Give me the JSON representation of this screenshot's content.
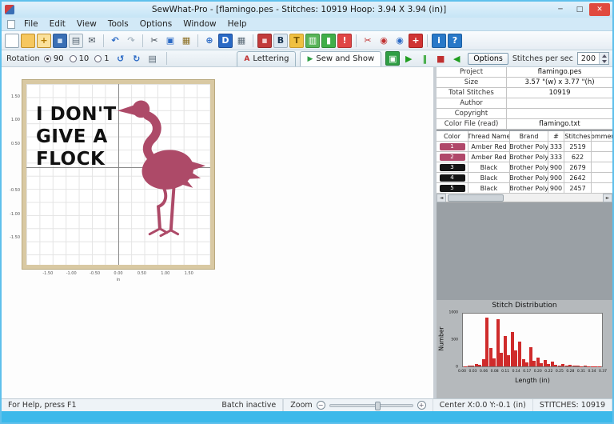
{
  "window": {
    "title": "SewWhat-Pro - [flamingo.pes - Stitches: 10919  Hoop: 3.94 X 3.94 (in)]",
    "controls": {
      "minimize": "─",
      "maximize": "□",
      "close": "✕"
    }
  },
  "menu": {
    "items": [
      "File",
      "Edit",
      "View",
      "Tools",
      "Options",
      "Window",
      "Help"
    ]
  },
  "toolbar": {
    "icons": [
      {
        "name": "new-document-icon",
        "glyph": "",
        "bg": "#ffffff",
        "bd": "#8fa3b2"
      },
      {
        "name": "open-folder-icon",
        "glyph": "",
        "bg": "#f6c75f",
        "bd": "#bf8f2a"
      },
      {
        "name": "merge-file-icon",
        "glyph": "+",
        "fg": "#b07800",
        "bg": "#fbe19b",
        "bd": "#bf8f2a"
      },
      {
        "name": "save-icon",
        "glyph": "▪",
        "fg": "#cfe0f4",
        "bg": "#3a6fb5",
        "bd": "#2c5a98"
      },
      {
        "name": "print-icon",
        "glyph": "▤",
        "fg": "#5a6a77",
        "bg": "#e8eef2",
        "bd": "#9fb0bd"
      },
      {
        "name": "email-icon",
        "glyph": "✉",
        "fg": "#4a5560"
      },
      {
        "sep": true
      },
      {
        "name": "undo-icon",
        "glyph": "↶",
        "fg": "#2a69c5"
      },
      {
        "name": "redo-icon",
        "glyph": "↷",
        "fg": "#a8b6c2"
      },
      {
        "sep": true
      },
      {
        "name": "cut-icon",
        "glyph": "✂",
        "fg": "#3c4650"
      },
      {
        "name": "copy-icon",
        "glyph": "▣",
        "fg": "#2a69c5"
      },
      {
        "name": "paste-icon",
        "glyph": "▦",
        "fg": "#8a6d1f"
      },
      {
        "sep": true
      },
      {
        "name": "zoom-icon",
        "glyph": "⊕",
        "fg": "#2a69c5"
      },
      {
        "name": "hoop-icon",
        "glyph": "D",
        "fg": "#ffffff",
        "bg": "#2a69c5",
        "bd": "#1d4e9a"
      },
      {
        "name": "grid-icon",
        "glyph": "▦",
        "fg": "#5a6a77"
      },
      {
        "sep": true
      },
      {
        "name": "save-design-icon",
        "glyph": "▪",
        "fg": "#f3d1d1",
        "bg": "#c23b3b",
        "bd": "#962c2c"
      },
      {
        "name": "lettering-icon",
        "glyph": "B",
        "fg": "#16324e",
        "bg": "#dce8f2",
        "bd": "#9fb0bd"
      },
      {
        "name": "thread-spool-icon",
        "glyph": "T",
        "fg": "#7a5800",
        "bg": "#f0c040",
        "bd": "#c79a2e"
      },
      {
        "name": "palette-icon",
        "glyph": "▥",
        "fg": "#ffffff",
        "bg": "#58b458",
        "bd": "#3f8f3f"
      },
      {
        "name": "density-chart-icon",
        "glyph": "▮",
        "fg": "#ffffff",
        "bg": "#3fae49",
        "bd": "#2f8a38"
      },
      {
        "name": "warning-icon",
        "glyph": "!",
        "fg": "#ffffff",
        "bg": "#e04545",
        "bd": "#b33232"
      },
      {
        "sep": true
      },
      {
        "name": "split-design-icon",
        "glyph": "✂",
        "fg": "#c03030"
      },
      {
        "name": "join-threads-red-icon",
        "glyph": "◉",
        "fg": "#c03030"
      },
      {
        "name": "join-threads-blue-icon",
        "glyph": "◉",
        "fg": "#2a69c5"
      },
      {
        "name": "flag-icon",
        "glyph": "+",
        "fg": "#ffffff",
        "bg": "#d03434",
        "bd": "#a82222"
      },
      {
        "sep": true
      },
      {
        "name": "info-icon",
        "glyph": "i",
        "fg": "#ffffff",
        "bg": "#2878c8",
        "bd": "#1d5ea0"
      },
      {
        "name": "help-icon",
        "glyph": "?",
        "fg": "#ffffff",
        "bg": "#2878c8",
        "bd": "#1d5ea0"
      }
    ]
  },
  "toolbar2": {
    "rotation_label": "Rotation",
    "rotation_options": [
      {
        "label": "90",
        "selected": true
      },
      {
        "label": "10",
        "selected": false
      },
      {
        "label": "1",
        "selected": false
      }
    ],
    "left_icons": [
      {
        "name": "rotate-ccw-icon",
        "glyph": "↺",
        "fg": "#2a69c5"
      },
      {
        "name": "rotate-cw-icon",
        "glyph": "↻",
        "fg": "#2a69c5"
      },
      {
        "name": "print-design-icon",
        "glyph": "▤",
        "fg": "#5a6a77"
      }
    ],
    "lettering_tab": {
      "icon": "A",
      "label": "Lettering"
    },
    "sewshow_tab": {
      "icon": "▶",
      "label": "Sew and Show"
    },
    "playback_icons": [
      {
        "name": "sew-simulator-icon",
        "glyph": "▣",
        "fg": "#ffffff",
        "bg": "#2f9e44",
        "bd": "#227a33"
      },
      {
        "name": "play-icon",
        "glyph": "▶",
        "fg": "#1f9d1f"
      },
      {
        "name": "pause-icon",
        "glyph": "‖",
        "fg": "#1f9d1f"
      },
      {
        "name": "stop-icon",
        "glyph": "■",
        "fg": "#c03030"
      },
      {
        "name": "rewind-icon",
        "glyph": "◀",
        "fg": "#1f9d1f"
      }
    ],
    "options_button": "Options",
    "sps_label": "Stitches per sec",
    "sps_value": "200"
  },
  "canvas": {
    "text_lines": [
      "I DON'T",
      "GIVE A",
      "FLOCK"
    ],
    "text_color": "#111111",
    "flamingo_color": "#ad4a68",
    "ruler_x": [
      "-1.50",
      "-1.00",
      "-0.50",
      "0.00",
      "0.50",
      "1.00",
      "1.50"
    ],
    "ruler_y": [
      "1.50",
      "1.00",
      "0.50",
      "-0.50",
      "-1.00",
      "-1.50"
    ],
    "unit": "in"
  },
  "project": {
    "rows": [
      {
        "label": "Project",
        "value": "flamingo.pes"
      },
      {
        "label": "Size",
        "value": "3.57 \"(w) x 3.77 \"(h)"
      },
      {
        "label": "Total Stitches",
        "value": "10919"
      },
      {
        "label": "Author",
        "value": ""
      },
      {
        "label": "Copyright",
        "value": ""
      },
      {
        "label": "Color File (read)",
        "value": "flamingo.txt"
      }
    ]
  },
  "threads": {
    "headers": [
      "Color",
      "Thread Name",
      "Brand",
      "#",
      "Stitches",
      "Comment"
    ],
    "rows": [
      {
        "num": "1",
        "swatch": "#b0486a",
        "name": "Amber Red",
        "brand": "Brother Poly",
        "code": "333",
        "stitches": "2519",
        "comment": ""
      },
      {
        "num": "2",
        "swatch": "#b0486a",
        "name": "Amber Red",
        "brand": "Brother Poly",
        "code": "333",
        "stitches": "622",
        "comment": ""
      },
      {
        "num": "3",
        "swatch": "#141414",
        "name": "Black",
        "brand": "Brother Poly",
        "code": "900",
        "stitches": "2679",
        "comment": ""
      },
      {
        "num": "4",
        "swatch": "#141414",
        "name": "Black",
        "brand": "Brother Poly",
        "code": "900",
        "stitches": "2642",
        "comment": ""
      },
      {
        "num": "5",
        "swatch": "#141414",
        "name": "Black",
        "brand": "Brother Poly",
        "code": "900",
        "stitches": "2457",
        "comment": ""
      }
    ]
  },
  "chart_data": {
    "type": "bar",
    "title": "Stitch Distribution",
    "xlabel": "Length (in)",
    "ylabel": "Number",
    "x_ticks": [
      "0.00",
      "0.03",
      "0.06",
      "0.08",
      "0.11",
      "0.14",
      "0.17",
      "0.20",
      "0.22",
      "0.25",
      "0.28",
      "0.31",
      "0.34",
      "0.37"
    ],
    "y_ticks": [
      "0",
      "500",
      "1000"
    ],
    "ylim": [
      0,
      1100
    ],
    "bar_color": "#cf2b2b",
    "values": [
      8,
      15,
      25,
      45,
      30,
      150,
      1020,
      380,
      160,
      980,
      290,
      640,
      240,
      720,
      330,
      510,
      150,
      85,
      400,
      110,
      190,
      75,
      130,
      55,
      95,
      38,
      22,
      55,
      18,
      30,
      10,
      16,
      7,
      9,
      4,
      5,
      3,
      2
    ],
    "legend": null,
    "grid": false
  },
  "statusbar": {
    "help": "For Help, press F1",
    "batch": "Batch inactive",
    "zoom_label": "Zoom",
    "center": "Center X:0.0  Y:-0.1 (in)",
    "stitches": "STITCHES: 10919"
  },
  "ui": {
    "scroll_left": "◄",
    "scroll_right": "►",
    "zoom_minus": "−",
    "zoom_plus": "+"
  },
  "colors": {
    "accent_pink": "#ad4a68",
    "titlebar_blue": "#c6e5f6",
    "window_border": "#3cb9ea",
    "bar_red": "#cf2b2b"
  }
}
